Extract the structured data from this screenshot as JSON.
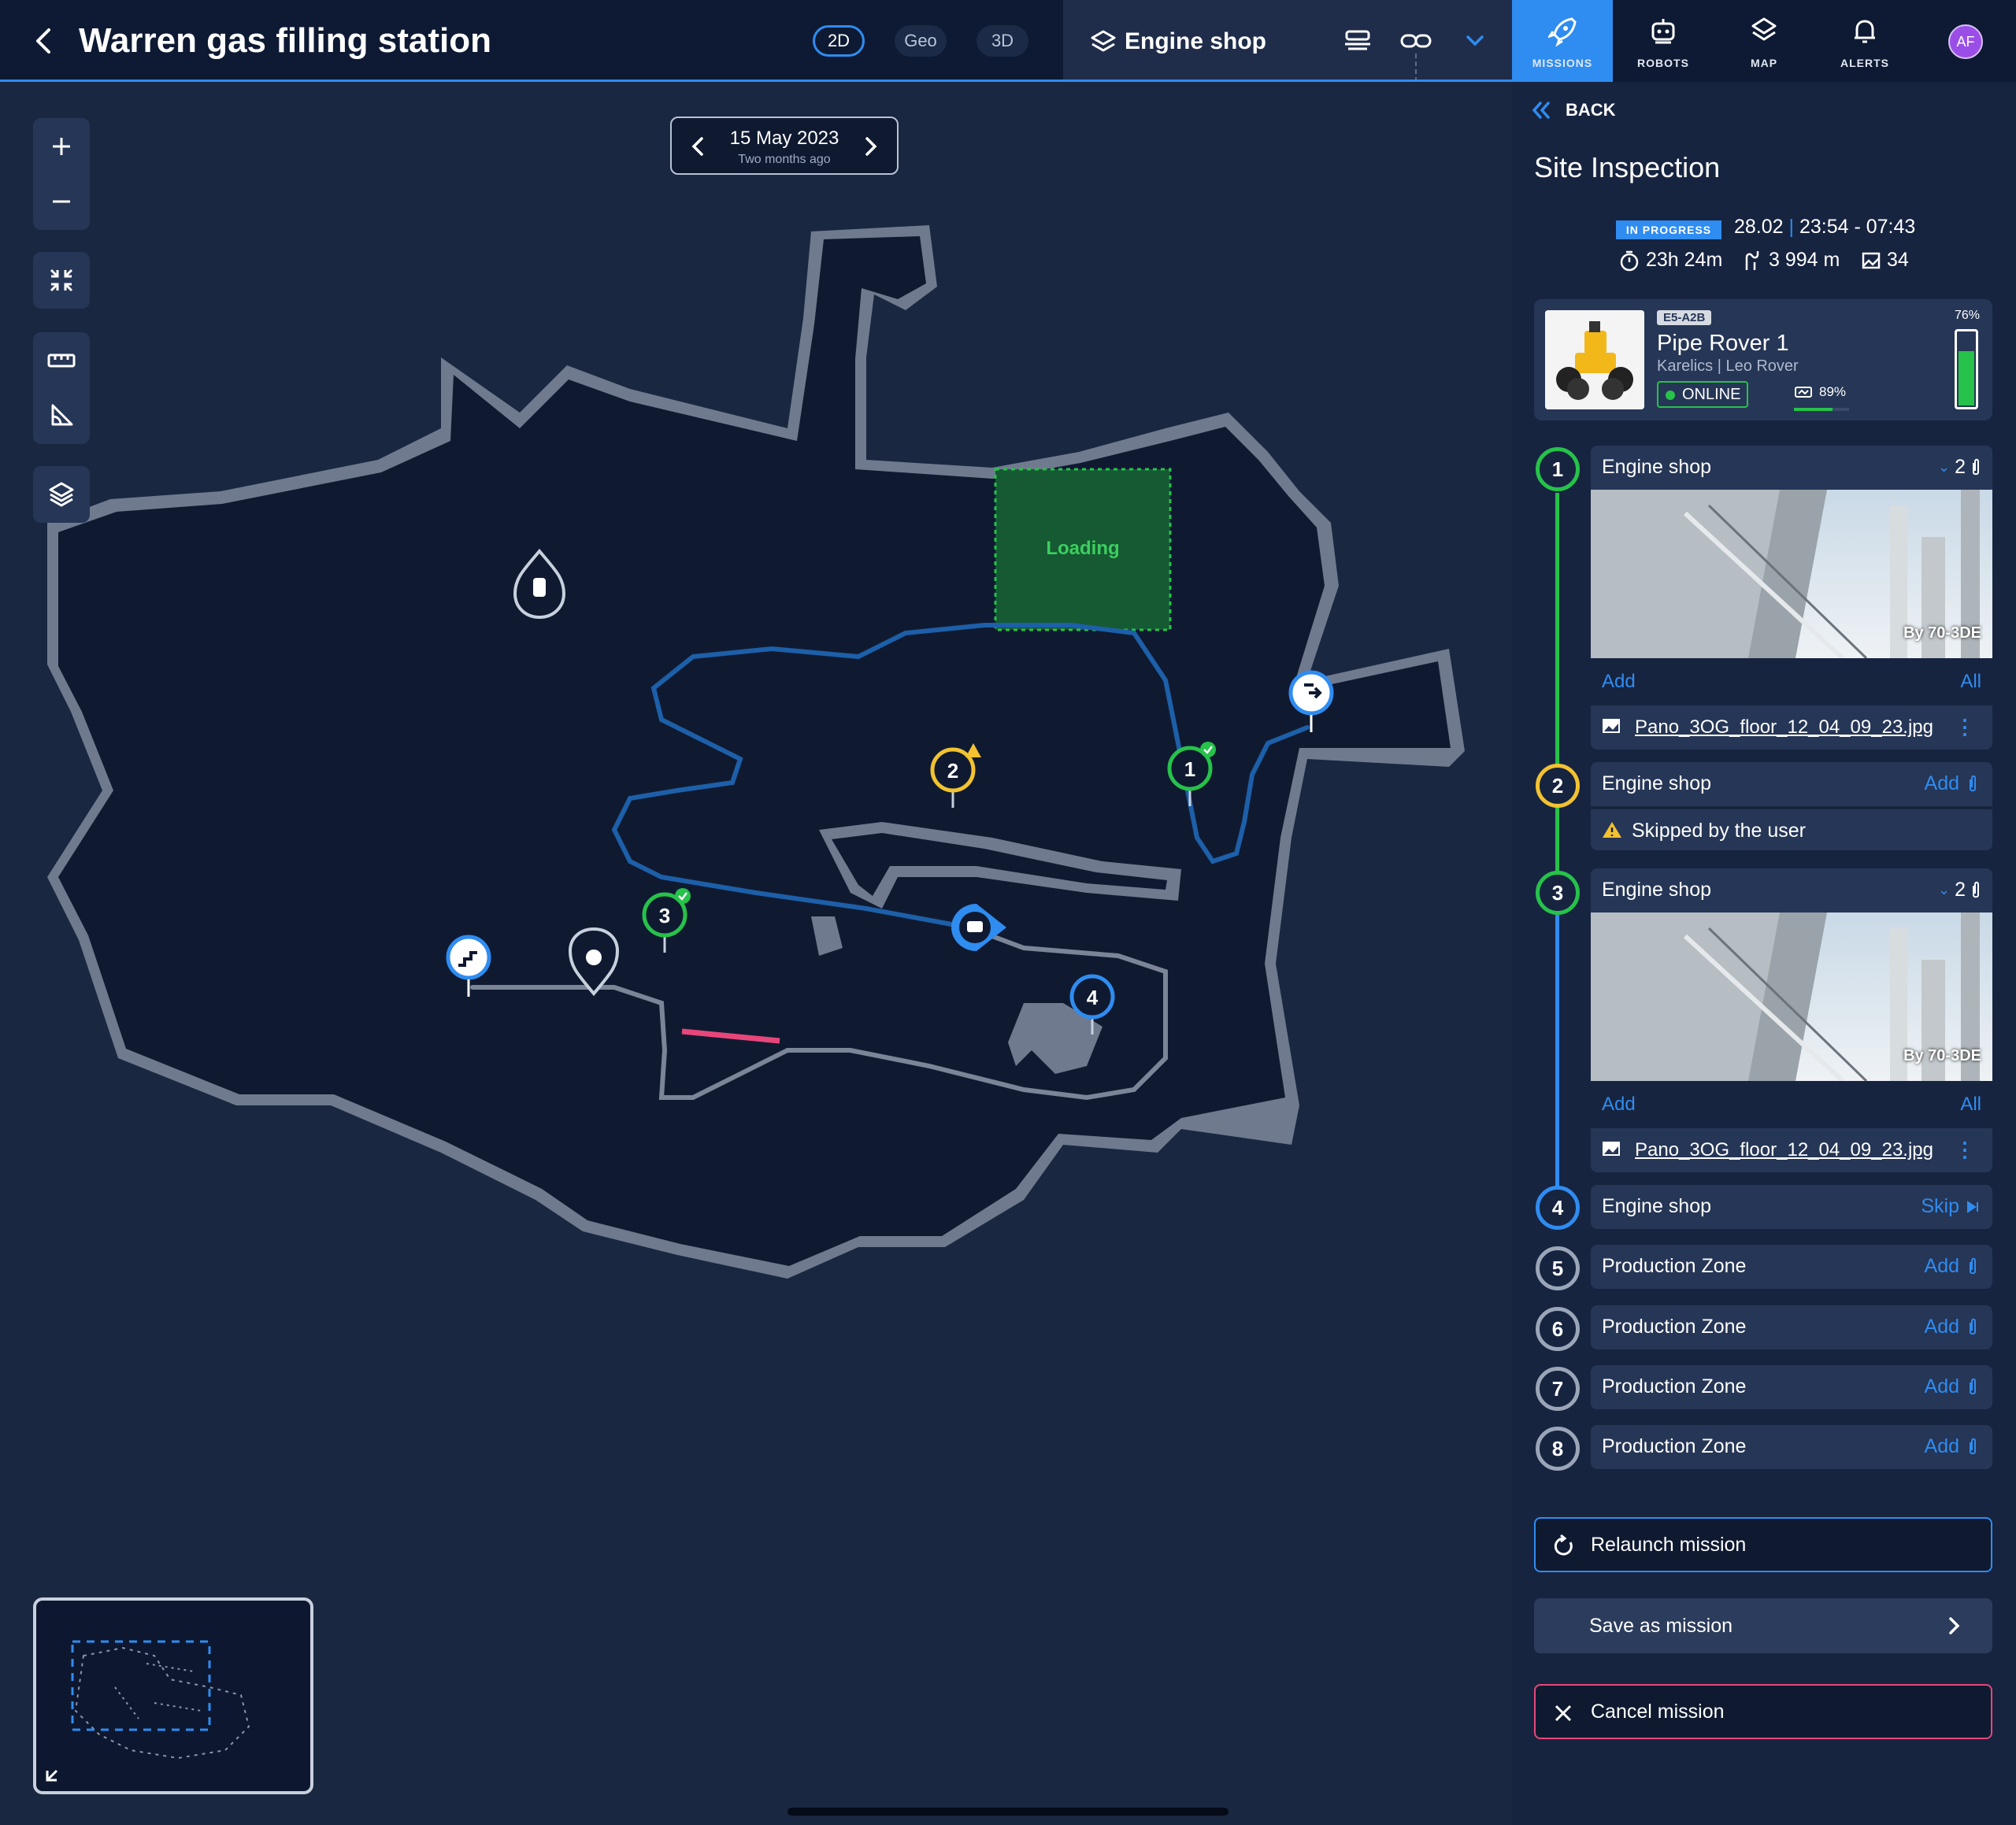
{
  "header": {
    "title": "Warren gas filling station",
    "view_modes": [
      "2D",
      "Geo",
      "3D"
    ],
    "active_view": "2D",
    "floor_name": "Engine shop",
    "accent_color": "#2f8cf0"
  },
  "nav": {
    "tabs": [
      {
        "label": "MISSIONS",
        "icon": "rocket-icon",
        "active": true
      },
      {
        "label": "ROBOTS",
        "icon": "robot-icon",
        "active": false
      },
      {
        "label": "MAP",
        "icon": "layers-icon",
        "active": false
      },
      {
        "label": "ALERTS",
        "icon": "bell-icon",
        "active": false
      }
    ],
    "avatar_initials": "AF"
  },
  "map": {
    "date": "15 May 2023",
    "date_relative": "Two months ago",
    "zone_label": "Loading",
    "waypoints": [
      {
        "number": "1",
        "status": "done",
        "color": "#26c24a"
      },
      {
        "number": "2",
        "status": "warning",
        "color": "#f2c230"
      },
      {
        "number": "3",
        "status": "done",
        "color": "#26c24a"
      },
      {
        "number": "4",
        "status": "current",
        "color": "#2f8cf0"
      }
    ],
    "tools": [
      "zoom-in-icon",
      "zoom-out-icon",
      "fit-icon",
      "ruler-icon",
      "angle-icon",
      "layers-icon"
    ]
  },
  "panel": {
    "back_label": "BACK",
    "mission_title": "Site Inspection",
    "status": "IN PROGRESS",
    "date": "28.02",
    "time_range": "23:54 - 07:43",
    "duration": "23h 24m",
    "distance": "3 994 m",
    "images": "34",
    "robot": {
      "id": "E5-A2B",
      "name": "Pipe Rover 1",
      "subtitle": "Karelics | Leo Rover",
      "status": "ONLINE",
      "signal": "89%",
      "battery": "76%",
      "battery_level": 0.76
    },
    "steps": [
      {
        "number": "1",
        "zone": "Engine shop",
        "state": "done",
        "count": "2",
        "add": "Add",
        "all": "All",
        "photo_by": "By 70-3DE",
        "file": "Pano_3OG_floor_12_04_09_23.jpg"
      },
      {
        "number": "2",
        "zone": "Engine shop",
        "state": "skipped",
        "action": "Add",
        "note": "Skipped by the user"
      },
      {
        "number": "3",
        "zone": "Engine shop",
        "state": "done",
        "count": "2",
        "add": "Add",
        "all": "All",
        "photo_by": "By 70-3DE",
        "file": "Pano_3OG_floor_12_04_09_23.jpg"
      },
      {
        "number": "4",
        "zone": "Engine shop",
        "state": "current",
        "action": "Skip"
      },
      {
        "number": "5",
        "zone": "Production Zone",
        "state": "pending",
        "action": "Add"
      },
      {
        "number": "6",
        "zone": "Production Zone",
        "state": "pending",
        "action": "Add"
      },
      {
        "number": "7",
        "zone": "Production Zone",
        "state": "pending",
        "action": "Add"
      },
      {
        "number": "8",
        "zone": "Production Zone",
        "state": "pending",
        "action": "Add"
      }
    ],
    "buttons": {
      "relaunch": "Relaunch mission",
      "save": "Save as mission",
      "cancel": "Cancel mission"
    }
  }
}
